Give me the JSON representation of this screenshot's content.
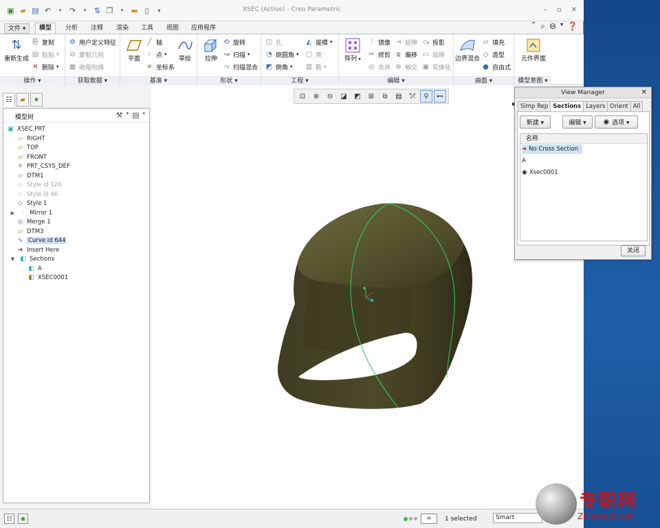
{
  "window": {
    "title": "XSEC (Active) - Creo Parametric"
  },
  "ribbon_tabs": [
    {
      "label": "文件 ▾"
    },
    {
      "label": "模型"
    },
    {
      "label": "分析"
    },
    {
      "label": "注释"
    },
    {
      "label": "渲染"
    },
    {
      "label": "工具"
    },
    {
      "label": "视图"
    },
    {
      "label": "应用程序"
    }
  ],
  "groups": {
    "operations": {
      "label": "操作 ▾",
      "regenerate": "重新生成",
      "copy": "复制",
      "paste": "粘贴",
      "delete": "删除"
    },
    "get_data": {
      "label": "获取数据 ▾",
      "udf": "用户定义特征",
      "copy_geom": "复制几何",
      "shrinkwrap": "收缩包络"
    },
    "datum": {
      "label": "基准 ▾",
      "plane": "平面",
      "axis": "轴",
      "point": "点",
      "csys": "坐标系",
      "sketch": "草绘"
    },
    "shapes": {
      "label": "形状 ▾",
      "extrude": "拉伸",
      "revolve": "旋转",
      "sweep": "扫描",
      "swept_blend": "扫描混合"
    },
    "engineering": {
      "label": "工程 ▾",
      "hole": "孔",
      "draft": "拔模",
      "round": "倒圆角",
      "shell": "壳",
      "chamfer": "倒角",
      "rib": "筋"
    },
    "editing": {
      "label": "编辑 ▾",
      "pattern": "阵列",
      "mirror": "镜像",
      "extend": "延伸",
      "project": "投影",
      "trim": "修剪",
      "offset": "偏移",
      "thicken": "加厚",
      "merge": "合并",
      "intersect": "相交",
      "solidify": "实体化"
    },
    "surfaces": {
      "label": "曲面 ▾",
      "boundary_blend": "边界混合",
      "fill": "填充",
      "style": "造型",
      "freestyle": "自由式"
    },
    "model_intent": {
      "label": "模型意图 ▾",
      "component_interface": "元件界面"
    }
  },
  "model_tree": {
    "header": "模型树",
    "items": [
      {
        "label": "XSEC.PRT",
        "icon": "part-icon"
      },
      {
        "label": "RIGHT",
        "icon": "datum-plane-icon"
      },
      {
        "label": "TOP",
        "icon": "datum-plane-icon"
      },
      {
        "label": "FRONT",
        "icon": "datum-plane-icon"
      },
      {
        "label": "PRT_CSYS_DEF",
        "icon": "csys-icon"
      },
      {
        "label": "DTM1",
        "icon": "datum-plane-icon"
      },
      {
        "label": "Style id 126",
        "icon": "style-icon"
      },
      {
        "label": "Style id 46",
        "icon": "style-icon"
      },
      {
        "label": "Style 1",
        "icon": "style-icon"
      },
      {
        "label": "Mirror 1",
        "icon": "mirror-icon"
      },
      {
        "label": "Merge 1",
        "icon": "merge-icon"
      },
      {
        "label": "DTM3",
        "icon": "datum-plane-icon"
      },
      {
        "label": "Curve id 644",
        "icon": "curve-icon"
      },
      {
        "label": "Insert Here",
        "icon": "insert-arrow-icon"
      },
      {
        "label": "Sections",
        "icon": "sections-icon"
      },
      {
        "label": "A",
        "icon": "section-icon"
      },
      {
        "label": "XSEC0001",
        "icon": "section-icon"
      }
    ]
  },
  "view_manager": {
    "title": "View Manager",
    "tabs": [
      {
        "label": "Simp Rep"
      },
      {
        "label": "Sections"
      },
      {
        "label": "Layers"
      },
      {
        "label": "Orient"
      },
      {
        "label": "All"
      }
    ],
    "new_btn": "新建 ▾",
    "edit_btn": "编辑 ▾",
    "options_btn": "选项 ▾",
    "list_header": "名称",
    "rows": [
      {
        "label": "No Cross Section"
      },
      {
        "label": "A"
      },
      {
        "label": "Xsec0001"
      }
    ],
    "close_btn": "关闭"
  },
  "status": {
    "selected": "1 selected",
    "filter": "Smart"
  },
  "watermark": {
    "text": "专职网",
    "url": "Zhuanzhi.Net"
  },
  "colors": {
    "model_fill": "#5a5630",
    "section_curve": "#2bd15a",
    "accent": "#cfe2f5"
  }
}
